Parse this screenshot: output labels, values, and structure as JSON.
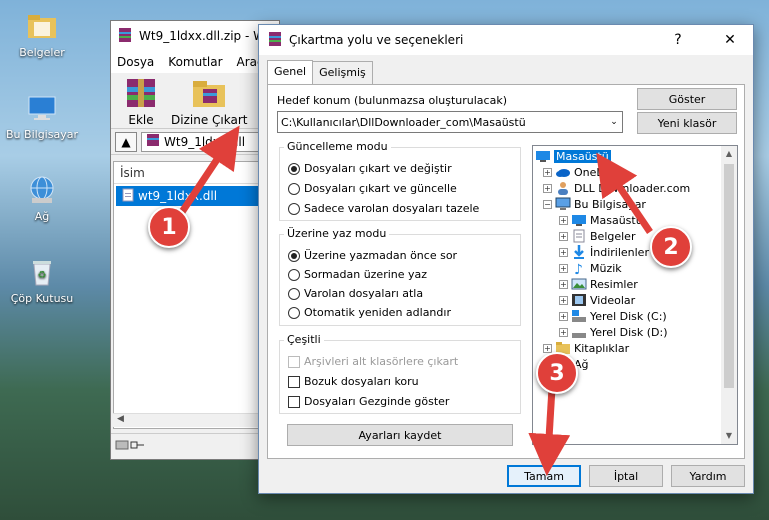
{
  "desktop": {
    "icons": [
      {
        "label": "Belgeler",
        "icon": "folder-icon"
      },
      {
        "label": "Bu Bilgisayar",
        "icon": "computer-icon"
      },
      {
        "label": "Ağ",
        "icon": "network-icon"
      },
      {
        "label": "Çöp Kutusu",
        "icon": "recycle-bin-icon"
      }
    ]
  },
  "winrar": {
    "title": "Wt9_1ldxx.dll.zip - W",
    "menu": [
      "Dosya",
      "Komutlar",
      "Araçla"
    ],
    "toolbar": {
      "add_label": "Ekle",
      "extract_label": "Dizine Çıkart"
    },
    "path_text": "Wt9_1ldxx.dll",
    "column_name": "İsim",
    "file_name": "wt9_1ldxx.dll"
  },
  "dialog": {
    "title": "Çıkartma yolu ve seçenekleri",
    "help_glyph": "?",
    "close_glyph": "✕",
    "tabs": [
      "Genel",
      "Gelişmiş"
    ],
    "dest_label": "Hedef konum (bulunmazsa oluşturulacak)",
    "dest_value": "C:\\Kullanıcılar\\DllDownloader_com\\Masaüstü",
    "show_button": "Göster",
    "new_folder_button": "Yeni klasör",
    "update_mode": {
      "title": "Güncelleme modu",
      "options": [
        "Dosyaları çıkart ve değiştir",
        "Dosyaları çıkart ve güncelle",
        "Sadece varolan dosyaları tazele"
      ],
      "selected": 0
    },
    "overwrite_mode": {
      "title": "Üzerine yaz modu",
      "options": [
        "Üzerine yazmadan önce sor",
        "Sormadan üzerine yaz",
        "Varolan dosyaları atla",
        "Otomatik yeniden adlandır"
      ],
      "selected": 0
    },
    "misc": {
      "title": "Çeşitli",
      "options": [
        "Arşivleri alt klasörlere çıkart",
        "Bozuk dosyaları koru",
        "Dosyaları Gezginde göster"
      ]
    },
    "save_settings_button": "Ayarları kaydet",
    "tree": [
      {
        "label": "Masaüstü",
        "level": 0,
        "icon": "desktop-icon",
        "expander": "",
        "selected": true
      },
      {
        "label": "OneDrive",
        "level": 1,
        "icon": "onedrive-icon",
        "expander": "+"
      },
      {
        "label": "DLL Downloader.com",
        "level": 1,
        "icon": "user-icon",
        "expander": "+"
      },
      {
        "label": "Bu Bilgisayar",
        "level": 1,
        "icon": "computer-icon",
        "expander": "−"
      },
      {
        "label": "Masaüstü",
        "level": 2,
        "icon": "desktop-icon",
        "expander": "+"
      },
      {
        "label": "Belgeler",
        "level": 2,
        "icon": "documents-icon",
        "expander": "+"
      },
      {
        "label": "İndirilenler",
        "level": 2,
        "icon": "downloads-icon",
        "expander": "+"
      },
      {
        "label": "Müzik",
        "level": 2,
        "icon": "music-icon",
        "expander": "+"
      },
      {
        "label": "Resimler",
        "level": 2,
        "icon": "pictures-icon",
        "expander": "+"
      },
      {
        "label": "Videolar",
        "level": 2,
        "icon": "videos-icon",
        "expander": "+"
      },
      {
        "label": "Yerel Disk (C:)",
        "level": 2,
        "icon": "disk-icon",
        "expander": "+"
      },
      {
        "label": "Yerel Disk (D:)",
        "level": 2,
        "icon": "disk-icon",
        "expander": "+"
      },
      {
        "label": "Kitaplıklar",
        "level": 1,
        "icon": "library-icon",
        "expander": "+"
      },
      {
        "label": "Ağ",
        "level": 1,
        "icon": "network-icon",
        "expander": "+"
      }
    ],
    "ok_button": "Tamam",
    "cancel_button": "İptal",
    "help_button": "Yardım"
  },
  "annotations": {
    "badges": [
      "1",
      "2",
      "3"
    ],
    "color": "#e0403a"
  },
  "colors": {
    "accent": "#0078d7"
  }
}
